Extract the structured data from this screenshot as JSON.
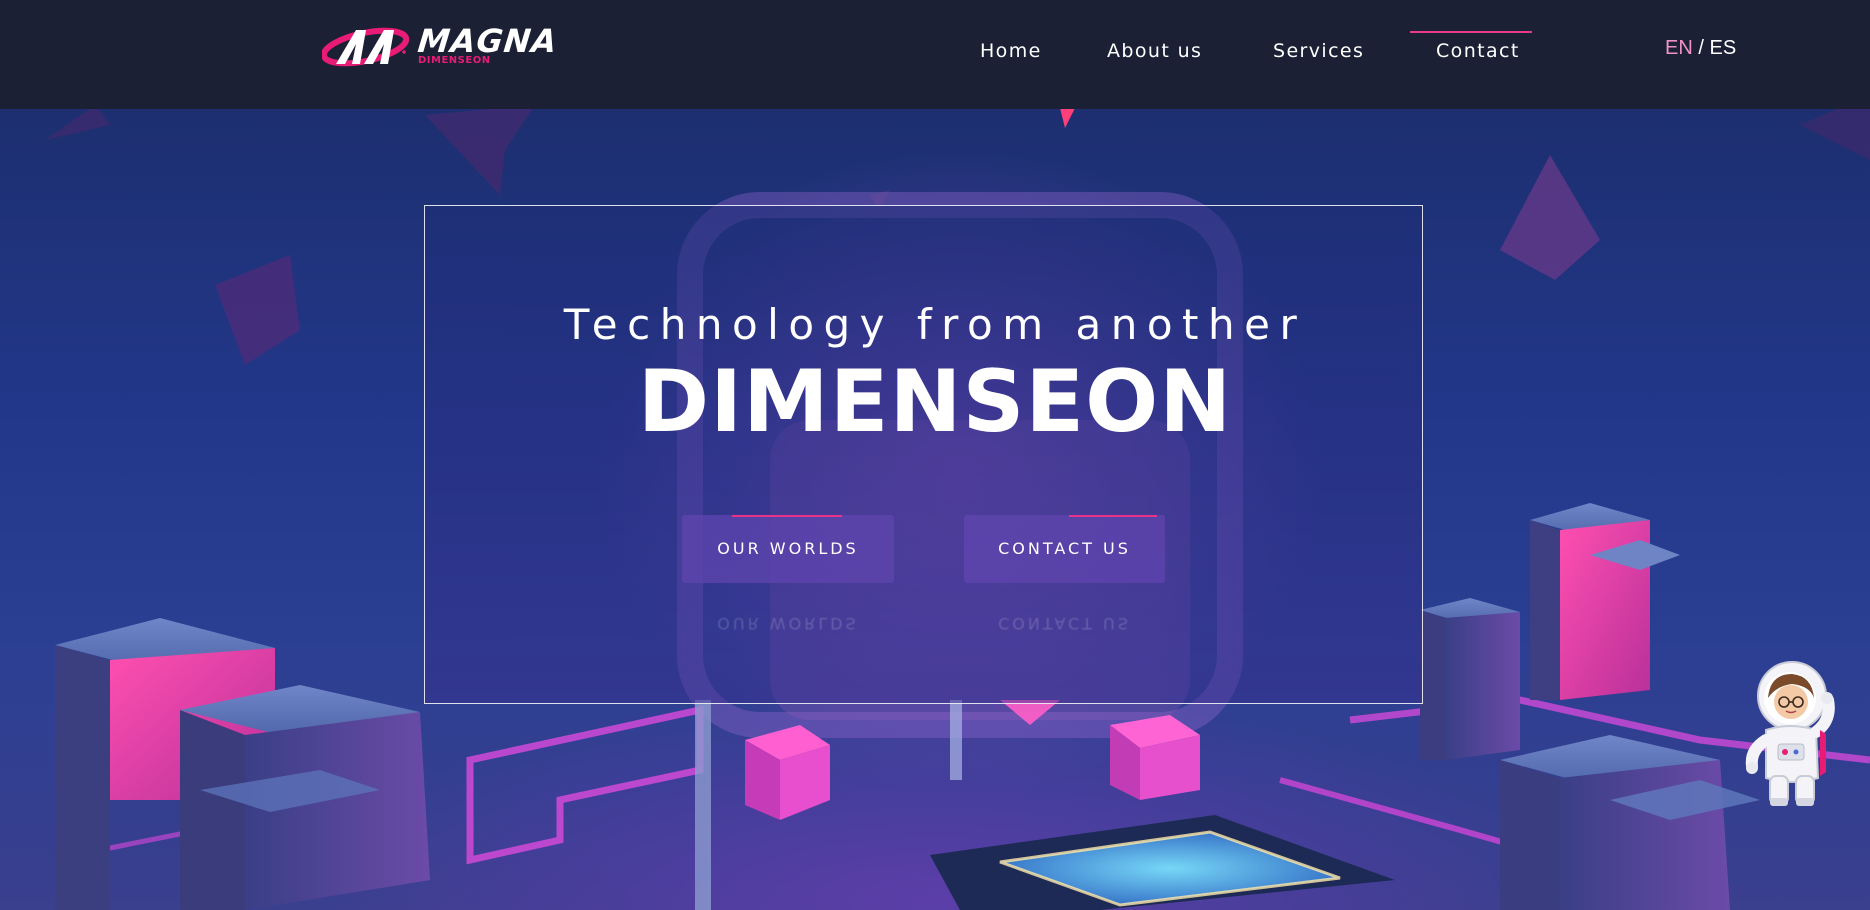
{
  "brand": {
    "name": "MAGNA",
    "subtitle": "DIMENSEON",
    "accent_color": "#e81c74"
  },
  "nav": {
    "items": [
      {
        "label": "Home"
      },
      {
        "label": "About us"
      },
      {
        "label": "Services"
      },
      {
        "label": "Contact",
        "active": true
      }
    ],
    "lang": {
      "en": "EN",
      "separator": "/",
      "es": "ES",
      "active": "EN"
    }
  },
  "hero": {
    "line1": "Technology from another",
    "line2": "DIMENSEON",
    "buttons": [
      {
        "label": "OUR WORLDS"
      },
      {
        "label": "CONTACT US"
      }
    ]
  },
  "mascot": {
    "icon": "astronaut-mascot-icon"
  },
  "colors": {
    "nav_bg": "#1b2035",
    "accent": "#e83a8a",
    "lang_active": "#f093c5"
  }
}
